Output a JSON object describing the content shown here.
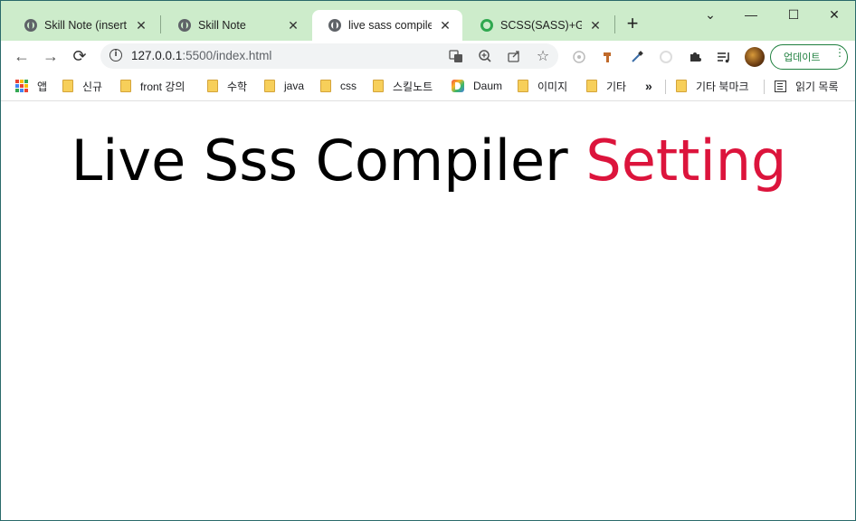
{
  "tabs": [
    {
      "title": "Skill Note (insert m",
      "active": false,
      "icon": "globe-icon"
    },
    {
      "title": "Skill Note",
      "active": false,
      "icon": "globe-icon"
    },
    {
      "title": "live sass compiler",
      "active": true,
      "icon": "globe-icon"
    },
    {
      "title": "SCSS(SASS)+GRID",
      "active": false,
      "icon": "sass-icon"
    }
  ],
  "new_tab_label": "+",
  "window_controls": {
    "chevron": "⌄",
    "minimize": "—",
    "maximize": "☐",
    "close": "✕"
  },
  "nav": {
    "back": "←",
    "forward": "→",
    "reload": "⟳"
  },
  "address": {
    "host": "127.0.0.1",
    "path": ":5500/index.html",
    "info_icon": "i"
  },
  "update_button": {
    "label": "업데이트",
    "menu": "⋮"
  },
  "bookmarks": [
    {
      "label": "앱",
      "icon": "apps-icon"
    },
    {
      "label": "신규",
      "icon": "folder-icon"
    },
    {
      "label": "front 강의",
      "icon": "folder-icon"
    },
    {
      "label": "수학",
      "icon": "folder-icon"
    },
    {
      "label": "java",
      "icon": "folder-icon"
    },
    {
      "label": "css",
      "icon": "folder-icon"
    },
    {
      "label": "스킬노트",
      "icon": "folder-icon"
    },
    {
      "label": "Daum",
      "icon": "daum-icon"
    },
    {
      "label": "이미지",
      "icon": "folder-icon"
    },
    {
      "label": "기타",
      "icon": "folder-icon"
    }
  ],
  "bookmarks_overflow": "»",
  "other_bookmarks": "기타 북마크",
  "reading_list": "읽기 목록",
  "page": {
    "heading_main": "Live Sss Compiler",
    "heading_accent": "Setting",
    "accent_color": "#dc143c"
  },
  "colors": {
    "tabstrip": "#cdeccb",
    "update_green": "#1e7f3e"
  }
}
